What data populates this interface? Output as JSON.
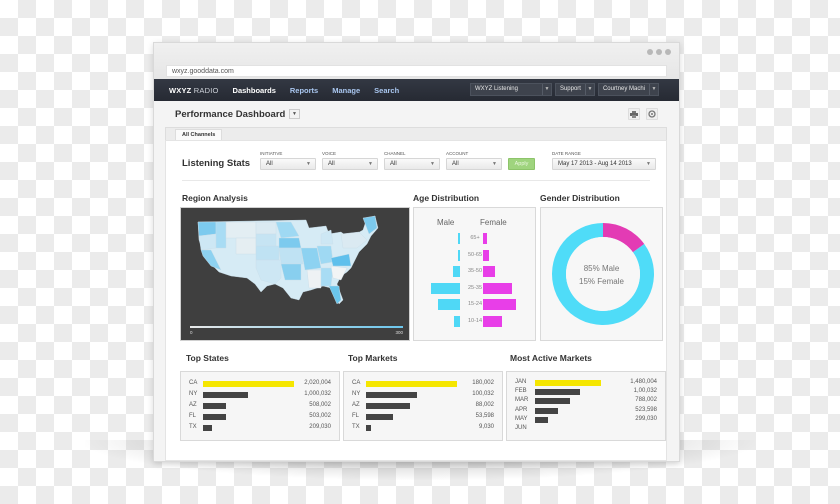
{
  "browser": {
    "url": "wxyz.gooddata.com"
  },
  "nav": {
    "brand_bold": "WXYZ",
    "brand_light": "RADIO",
    "links": [
      {
        "label": "Dashboards",
        "active": true
      },
      {
        "label": "Reports",
        "active": false
      },
      {
        "label": "Manage",
        "active": false
      },
      {
        "label": "Search",
        "active": false
      }
    ],
    "project_select": "WXYZ Listening",
    "support_label": "Support",
    "user_label": "Courtney Machi"
  },
  "page": {
    "title": "Performance Dashboard",
    "tabs": [
      {
        "label": "All Channels",
        "active": true
      }
    ],
    "print_icon": "printer-icon",
    "settings_icon": "gear-icon"
  },
  "filters": {
    "section_title": "Listening Stats",
    "items": [
      {
        "label": "INITIATIVE",
        "value": "All"
      },
      {
        "label": "VOICE",
        "value": "All"
      },
      {
        "label": "CHANNEL",
        "value": "All"
      },
      {
        "label": "ACCOUNT",
        "value": "All"
      }
    ],
    "apply_label": "Apply",
    "date_range": {
      "label": "DATE RANGE",
      "value": "May 17 2013 - Aug 14 2013"
    }
  },
  "region": {
    "title": "Region Analysis",
    "scale_min": "0",
    "scale_max": "300",
    "colors": {
      "low": "#e8e8e8",
      "high": "#6bc6ec",
      "background": "#3f3f3f"
    }
  },
  "chart_data": [
    {
      "type": "bar",
      "title": "Age Distribution",
      "orientation": "horizontal-pyramid",
      "categories": [
        "65+",
        "50-65",
        "35-50",
        "25-35",
        "15-24",
        "10-14"
      ],
      "series": [
        {
          "name": "Male",
          "color": "#4fd8f6",
          "values": [
            2,
            2,
            7,
            30,
            23,
            6
          ]
        },
        {
          "name": "Female",
          "color": "#e83ee8",
          "values": [
            4,
            6,
            12,
            30,
            34,
            20
          ]
        }
      ],
      "xlabel": "",
      "ylabel": ""
    },
    {
      "type": "pie",
      "title": "Gender Distribution",
      "donut": true,
      "labels": [
        "Male",
        "Female"
      ],
      "values": [
        85,
        15
      ],
      "colors": [
        "#4fdcf8",
        "#e33bb4"
      ],
      "center_lines": [
        "85% Male",
        "15% Female"
      ]
    },
    {
      "type": "bar",
      "title": "Top States",
      "categories": [
        "CA",
        "NY",
        "AZ",
        "FL",
        "TX"
      ],
      "values": [
        2020004,
        1000032,
        508002,
        503002,
        209030
      ],
      "value_labels": [
        "2,020,004",
        "1,000,032",
        "508,002",
        "503,002",
        "209,030"
      ],
      "highlight_color": "#f5e600",
      "bar_color": "#444444"
    },
    {
      "type": "bar",
      "title": "Top Markets",
      "categories": [
        "CA",
        "NY",
        "AZ",
        "FL",
        "TX"
      ],
      "values": [
        180002,
        100032,
        88002,
        53598,
        9030
      ],
      "value_labels": [
        "180,002",
        "100,032",
        "88,002",
        "53,598",
        "9,030"
      ],
      "highlight_color": "#f5e600",
      "bar_color": "#444444"
    },
    {
      "type": "bar",
      "title": "Most Active Markets",
      "categories": [
        "JAN",
        "FEB",
        "MAR",
        "APR",
        "MAY",
        "JUN"
      ],
      "values": [
        1480004,
        1000032,
        788002,
        523598,
        299030
      ],
      "value_labels": [
        "1,480,004",
        "1,00,032",
        "788,002",
        "523,598",
        "299,030"
      ],
      "highlight_color": "#f5e600",
      "bar_color": "#444444"
    }
  ]
}
